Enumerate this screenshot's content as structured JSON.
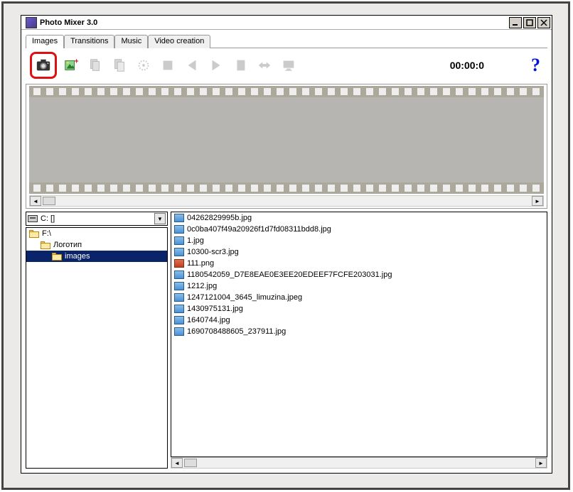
{
  "window": {
    "title": "Photo Mixer 3.0"
  },
  "tabs": [
    "Images",
    "Transitions",
    "Music",
    "Video creation"
  ],
  "active_tab": 0,
  "clock": "00:00:0",
  "drive": "C: []",
  "tree": [
    {
      "label": "F:\\",
      "indent": 0,
      "open": true,
      "selected": false
    },
    {
      "label": "Логотип",
      "indent": 1,
      "open": true,
      "selected": false
    },
    {
      "label": "images",
      "indent": 2,
      "open": true,
      "selected": true
    }
  ],
  "files": [
    {
      "name": "04262829995b.jpg",
      "kind": "image"
    },
    {
      "name": "0c0ba407f49a20926f1d7fd08311bdd8.jpg",
      "kind": "image"
    },
    {
      "name": "1.jpg",
      "kind": "image"
    },
    {
      "name": "10300-scr3.jpg",
      "kind": "image"
    },
    {
      "name": "111.png",
      "kind": "red"
    },
    {
      "name": "1180542059_D7E8EAE0E3EE20EDEEF7FCFE203031.jpg",
      "kind": "image"
    },
    {
      "name": "1212.jpg",
      "kind": "image"
    },
    {
      "name": "1247121004_3645_limuzina.jpeg",
      "kind": "image"
    },
    {
      "name": "1430975131.jpg",
      "kind": "image"
    },
    {
      "name": "1640744.jpg",
      "kind": "image"
    },
    {
      "name": "1690708488605_237911.jpg",
      "kind": "image"
    }
  ],
  "icons": {
    "camera": "camera",
    "add_image": "add-image",
    "copy": "copy",
    "paste": "paste",
    "settings": "settings",
    "stop": "stop",
    "prev": "prev",
    "next": "next",
    "page": "page",
    "swap": "swap",
    "monitor": "monitor",
    "help": "?"
  }
}
